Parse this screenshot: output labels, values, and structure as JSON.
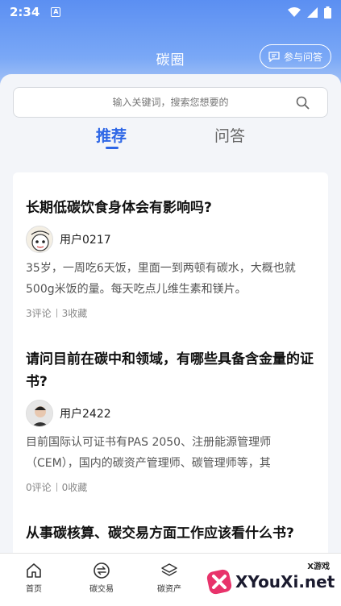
{
  "status_bar": {
    "time": "2:34",
    "indicator": "A"
  },
  "header": {
    "title": "碳圈",
    "ask_button": "参与问答"
  },
  "search": {
    "placeholder": "输入关键词，搜索您想要的"
  },
  "tabs": [
    {
      "label": "推荐",
      "active": true
    },
    {
      "label": "问答",
      "active": false
    }
  ],
  "posts": [
    {
      "title": "长期低碳饮食身体会有影响吗?",
      "author": "用户0217",
      "excerpt": "35岁，一周吃6天饭，里面一到两顿有碳水，大概也就500g米饭的量。每天吃点儿维生素和镁片。",
      "comments": "3评论",
      "favorites": "3收藏"
    },
    {
      "title": "请问目前在碳中和领域，有哪些具备含金量的证书?",
      "author": "用户2422",
      "excerpt": "目前国际认可证书有PAS 2050、注册能源管理师（CEM），国内的碳资产管理师、碳管理师等，其",
      "comments": "0评论",
      "favorites": "0收藏"
    },
    {
      "title": "从事碳核算、碳交易方面工作应该看什么书?"
    }
  ],
  "bottom_nav": [
    {
      "label": "首页",
      "icon": "home-icon"
    },
    {
      "label": "碳交易",
      "icon": "exchange-icon"
    },
    {
      "label": "碳资产",
      "icon": "layers-icon"
    }
  ],
  "watermark": {
    "small": "X游戏",
    "text": "XYouXi.net"
  },
  "colors": {
    "accent": "#2d66e6",
    "header_top": "#5b8ff2"
  }
}
